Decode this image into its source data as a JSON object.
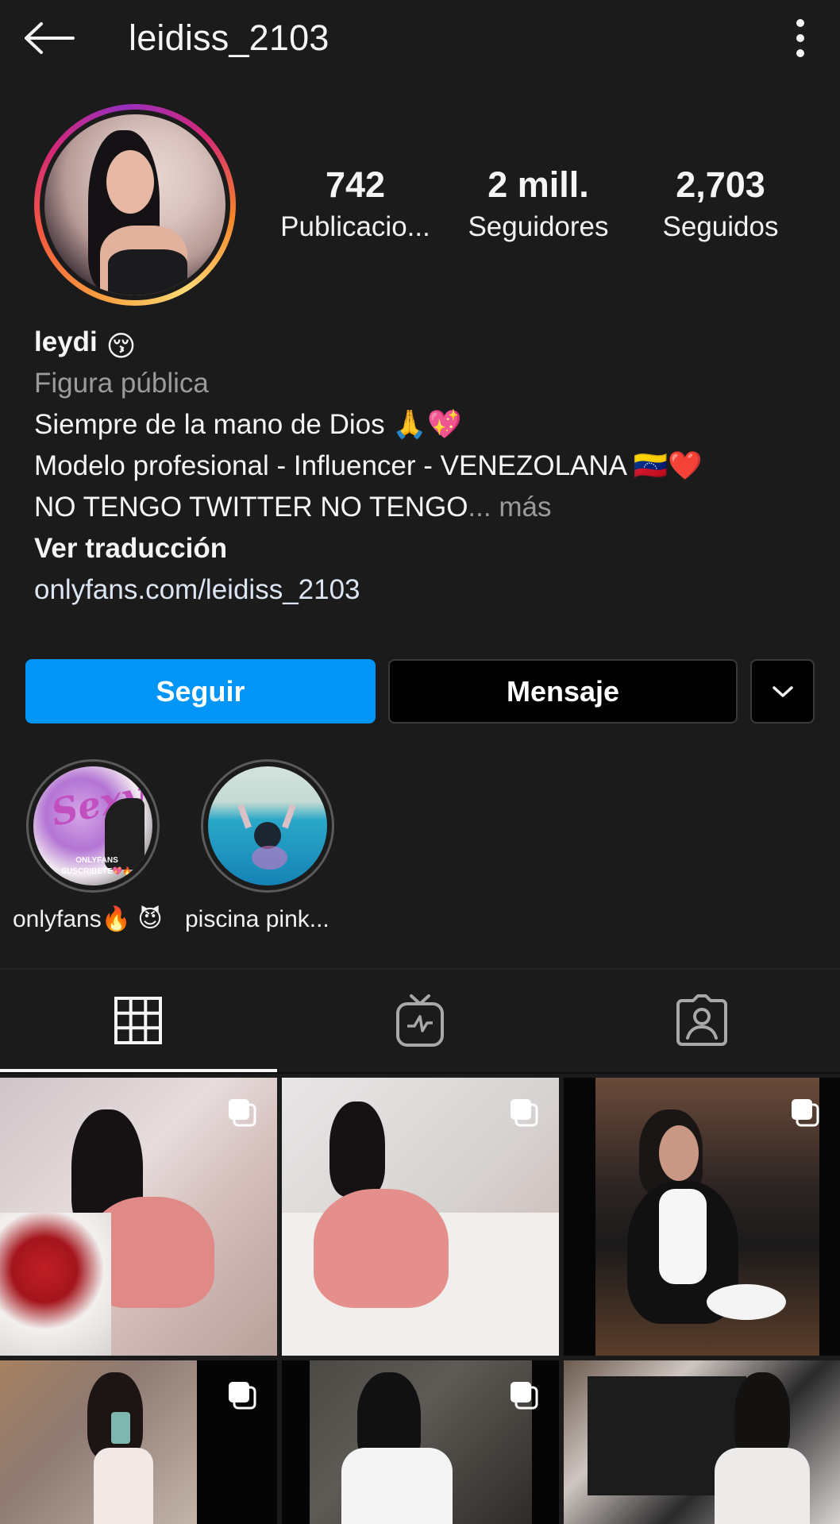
{
  "header": {
    "username": "leidiss_2103",
    "back_icon": "arrow-left-icon",
    "more_icon": "more-vertical-icon"
  },
  "stats": {
    "posts": {
      "value": "742",
      "label": "Publicacio..."
    },
    "followers": {
      "value": "2 mill.",
      "label": "Seguidores"
    },
    "following": {
      "value": "2,703",
      "label": "Seguidos"
    }
  },
  "bio": {
    "name": "leydi",
    "name_emoji": "😚",
    "category": "Figura pública",
    "line1": "Siempre de la mano de Dios",
    "line1_emoji": "🙏💖",
    "line2": "Modelo profesional - Influencer - VENEZOLANA",
    "line2_emoji": "🇻🇪❤️",
    "line3": "NO TENGO TWITTER NO TENGO",
    "line3_more": "... más",
    "translate": "Ver traducción",
    "link": "onlyfans.com/leidiss_2103"
  },
  "actions": {
    "follow_label": "Seguir",
    "message_label": "Mensaje",
    "dropdown_icon": "chevron-down-icon"
  },
  "highlights": [
    {
      "label": "onlyfans🔥 😈",
      "image_text": "Sexy",
      "image_subtext": "ONLYFANS SUSCRIBETE💖🔥"
    },
    {
      "label": "piscina pink..."
    }
  ],
  "tabs": [
    {
      "name": "posts",
      "icon": "grid-icon",
      "active": true
    },
    {
      "name": "igtv",
      "icon": "tv-icon",
      "active": false
    },
    {
      "name": "tagged",
      "icon": "tagged-user-icon",
      "active": false
    }
  ],
  "colors": {
    "background": "#1b1b1c",
    "accent": "#0095f6",
    "secondary_text": "#9b9b9b"
  }
}
